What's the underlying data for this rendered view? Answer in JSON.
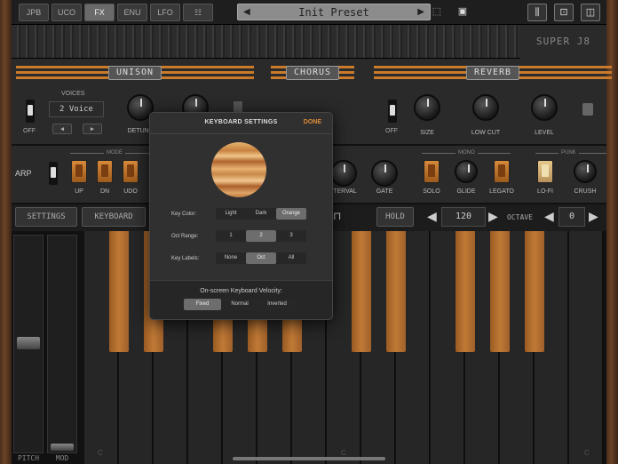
{
  "toolbar": {
    "tabs": [
      "JPB",
      "UCO",
      "FX",
      "ENU",
      "LFO"
    ],
    "active_tab": "FX",
    "preset_name": "Init Preset",
    "logo": "SUPER J8"
  },
  "unison": {
    "title": "UNISON",
    "voices_label": "VOICES",
    "voices_value": "2 Voice",
    "off_label": "OFF",
    "detune_label": "DETUNE"
  },
  "chorus": {
    "title": "CHORUS"
  },
  "reverb": {
    "title": "REVERB",
    "off_label": "OFF",
    "size_label": "SIZE",
    "lowcut_label": "LOW CUT",
    "level_label": "LEVEL"
  },
  "arp": {
    "title": "ARP",
    "mode_label": "MODE",
    "buttons": [
      "UP",
      "DN",
      "UDO"
    ],
    "interval_label": "INTERVAL",
    "gate_label": "GATE"
  },
  "mono": {
    "label": "MONO",
    "solo_label": "SOLO",
    "glide_label": "GLIDE",
    "legato_label": "LEGATO"
  },
  "punk": {
    "label": "PUNK",
    "lofi_label": "LO-FI",
    "crush_label": "CRUSH"
  },
  "controls": {
    "settings_label": "SETTINGS",
    "keyboard_label": "KEYBOARD",
    "hold_label": "HOLD",
    "tempo_value": "120",
    "octave_label": "OCTAVE",
    "octave_value": "0"
  },
  "wheels": {
    "pitch_label": "PITCH",
    "mod_label": "MOD"
  },
  "keyboard": {
    "c_labels": [
      "C",
      "C",
      "C"
    ]
  },
  "modal": {
    "title": "KEYBOARD SETTINGS",
    "done_label": "DONE",
    "key_color_label": "Key Color:",
    "key_color_options": [
      "Light",
      "Dark",
      "Orange"
    ],
    "key_color_selected": "Orange",
    "oct_range_label": "Oct Range:",
    "oct_range_options": [
      "1",
      "2",
      "3"
    ],
    "oct_range_selected": "2",
    "key_labels_label": "Key Labels:",
    "key_labels_options": [
      "None",
      "Oct",
      "All"
    ],
    "key_labels_selected": "Oct",
    "velocity_label": "On-screen Keyboard Velocity:",
    "velocity_options": [
      "Fixed",
      "Normal",
      "Inverted"
    ],
    "velocity_selected": "Fixed"
  },
  "colors": {
    "accent": "#c97a2a",
    "done": "#e08c3a",
    "panel": "#2a2a2a"
  }
}
